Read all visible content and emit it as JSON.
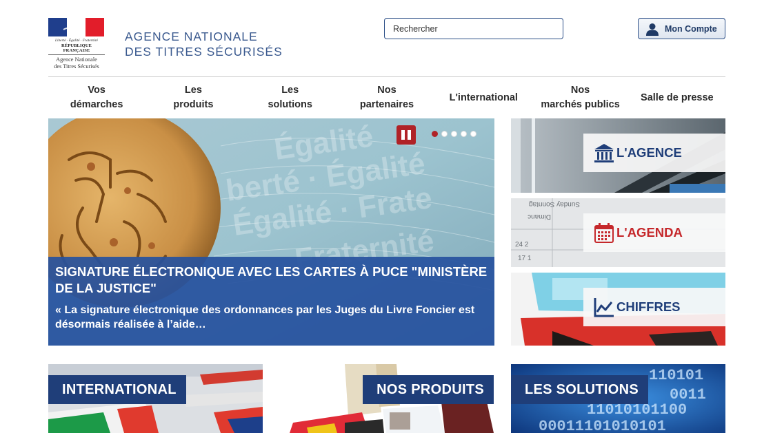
{
  "header": {
    "motto": "Liberté · Égalité · Fraternité",
    "republic": "RÉPUBLIQUE FRANÇAISE",
    "logo_agency_line1": "Agence Nationale",
    "logo_agency_line2": "des Titres Sécurisés",
    "title_line1": "AGENCE NATIONALE",
    "title_line2": "DES TITRES SÉCURISÉS",
    "search_placeholder": "Rechercher",
    "account_label": "Mon Compte"
  },
  "nav": {
    "items": [
      {
        "line1": "Vos",
        "line2": "démarches"
      },
      {
        "line1": "Les",
        "line2": "produits"
      },
      {
        "line1": "Les",
        "line2": "solutions"
      },
      {
        "line1": "Nos",
        "line2": "partenaires"
      },
      {
        "line1": "L'international",
        "line2": ""
      },
      {
        "line1": "Nos",
        "line2": "marchés publics"
      },
      {
        "line1": "Salle de presse",
        "line2": ""
      }
    ]
  },
  "slider": {
    "title": "SIGNATURE ÉLECTRONIQUE AVEC LES CARTES À PUCE \"MINISTÈRE DE LA JUSTICE\"",
    "text": "« La signature électronique des ordonnances par les Juges du Livre Foncier est désormais réalisée à l’aide…",
    "slide_count": 5,
    "active_slide": 1
  },
  "tiles": {
    "agence": "L'AGENCE",
    "agenda": "L'AGENDA",
    "chiffres": "CHIFFRES"
  },
  "bottom_tiles": {
    "international": "INTERNATIONAL",
    "produits": "NOS PRODUITS",
    "solutions": "LES SOLUTIONS"
  },
  "colors": {
    "primary_blue": "#1f3e79",
    "caption_blue": "#26519e",
    "accent_red": "#b02227"
  }
}
